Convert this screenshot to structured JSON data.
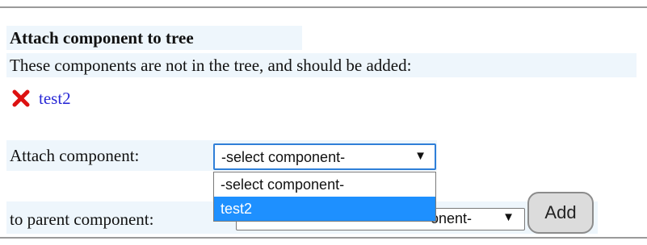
{
  "heading": "Attach component to tree",
  "intro": "These components are not in the tree, and should be added:",
  "missing": {
    "icon": "red-x-icon",
    "item": "test2",
    "icon_color": "#dd1111",
    "link_color": "#2a2ad6"
  },
  "attach": {
    "label": "Attach component:",
    "selected": "-select component-",
    "options": [
      "-select component-",
      "test2"
    ],
    "highlighted_option": "test2"
  },
  "parent": {
    "label": "to parent component:",
    "selected": "-select parent component-"
  },
  "add_button": "Add",
  "colors": {
    "highlight": "#1e90ff",
    "band": "#eef6fc",
    "focus_border": "#2f7fd8"
  }
}
